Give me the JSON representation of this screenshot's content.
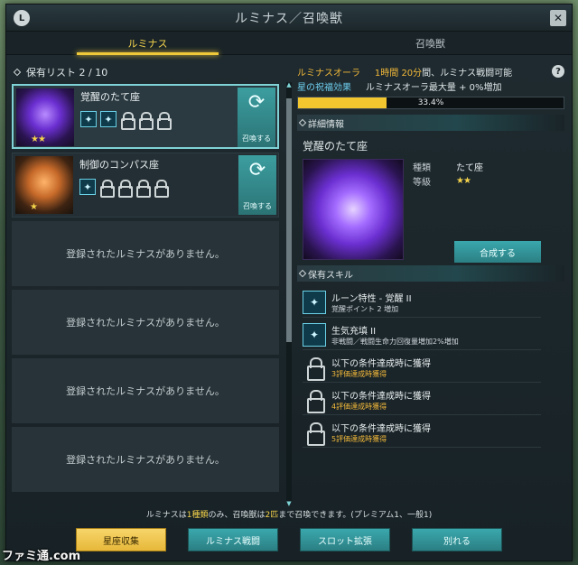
{
  "window": {
    "title": "ルミナス／召喚獣",
    "l_button": "L",
    "close": "✕"
  },
  "tabs": [
    {
      "label": "ルミナス",
      "active": true
    },
    {
      "label": "召喚獣",
      "active": false
    }
  ],
  "list": {
    "header": "保有リスト 2 / 10",
    "cards": [
      {
        "name": "覚醒のたて座",
        "stars": "★★",
        "slots_active": [
          "✦",
          "✦"
        ],
        "locks": 3,
        "summon_label": "召喚する",
        "summon_icon": "⟳"
      },
      {
        "name": "制御のコンパス座",
        "stars": "★",
        "slots_active": [
          "✦"
        ],
        "locks": 4,
        "summon_label": "召喚する",
        "summon_icon": "⟳"
      }
    ],
    "empty_text": "登録されたルミナスがありません。",
    "empty_count": 4
  },
  "aura": {
    "label": "ルミナスオーラ",
    "time": "1時間 20分",
    "time_suffix": "間、ルミナス戦闘可能",
    "blessing_label": "星の祝福効果",
    "blessing_value": "ルミナスオーラ最大量 + 0%増加",
    "progress_percent": 33.4,
    "progress_text": "33.4%",
    "help": "?"
  },
  "detail": {
    "header": "詳細情報",
    "name": "覚醒のたて座",
    "kind_key": "種類",
    "kind_val": "たて座",
    "grade_key": "等級",
    "grade_val": "★★",
    "compose_label": "合成する"
  },
  "skills": {
    "header": "保有スキル",
    "items": [
      {
        "type": "active",
        "icon": "✦",
        "title": "ルーン特性 - 覚醒 II",
        "desc": "覚醒ポイント 2 増加",
        "desc_gold": false
      },
      {
        "type": "active",
        "icon": "✦",
        "title": "生気充填 II",
        "desc": "非戦闘／戦闘生命力回復量増加2%増加",
        "desc_gold": false
      },
      {
        "type": "locked",
        "title": "以下の条件達成時に獲得",
        "desc": "3評価達成時獲得",
        "desc_gold": true
      },
      {
        "type": "locked",
        "title": "以下の条件達成時に獲得",
        "desc": "4評価達成時獲得",
        "desc_gold": true
      },
      {
        "type": "locked",
        "title": "以下の条件達成時に獲得",
        "desc": "5評価達成時獲得",
        "desc_gold": true
      }
    ]
  },
  "footer": {
    "note_pre": "ルミナスは",
    "note_hl1": "1種類",
    "note_mid": "のみ、召喚獣は",
    "note_hl2": "2匹",
    "note_post": "まで召喚できます。(プレミアム1、一般1)",
    "buttons": [
      {
        "label": "星座収集",
        "primary": true
      },
      {
        "label": "ルミナス戦闘",
        "primary": false
      },
      {
        "label": "スロット拡張",
        "primary": false
      },
      {
        "label": "別れる",
        "primary": false
      }
    ]
  },
  "watermark": "ファミ通.com",
  "colors": {
    "accent": "#f3d24b",
    "teal": "#3aa8ad",
    "cyan": "#6fd0f0",
    "gold": "#f3b93a"
  }
}
